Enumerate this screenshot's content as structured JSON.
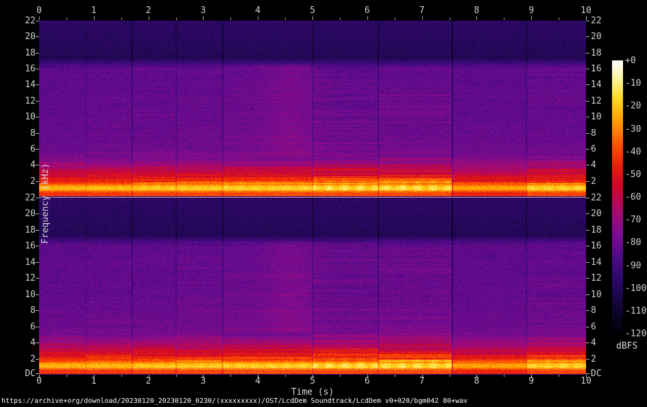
{
  "window": {
    "background": "#000000"
  },
  "footer": {
    "text": "https://archive+org/download/20230120_20230120_0230/(xxxxxxxxx)/OST/LcdDem Soundtrack/LcdDem v0+020/bgm042 80+wav"
  },
  "chart_data": {
    "type": "heatmap",
    "title": "",
    "description": "Stereo audio spectrogram (SoX style): two stacked channel panels, 0-10 s, DC-22 kHz, strong tonal energy below ~4.5 kHz, lowpass cutoff near 17 kHz, intensity scale 0 to -120 dBFS",
    "channels": 2,
    "x": {
      "label": "Time (s)",
      "min": 0,
      "max": 10,
      "major_ticks": [
        "0",
        "1",
        "2",
        "3",
        "4",
        "5",
        "6",
        "7",
        "8",
        "9",
        "10"
      ],
      "minor_step": 0.5
    },
    "y": {
      "label": "Frequency (kHz)",
      "min": 0,
      "max": 22,
      "tick_labels": [
        "22",
        "20",
        "18",
        "16",
        "14",
        "12",
        "10",
        "8",
        "6",
        "4",
        "2"
      ],
      "dc_label": "DC"
    },
    "colorbar": {
      "unit": "dBFS",
      "min": -120,
      "max": 0,
      "tick_labels": [
        "+0",
        "-10",
        "-20",
        "-30",
        "-40",
        "-50",
        "-60",
        "-70",
        "-80",
        "-90",
        "-100",
        "-110",
        "-120"
      ]
    },
    "palette_stops": [
      [
        0,
        255,
        255,
        255
      ],
      [
        -8,
        255,
        244,
        160
      ],
      [
        -16,
        255,
        220,
        40
      ],
      [
        -26,
        255,
        160,
        0
      ],
      [
        -36,
        255,
        90,
        0
      ],
      [
        -46,
        235,
        30,
        10
      ],
      [
        -56,
        205,
        5,
        45
      ],
      [
        -66,
        170,
        10,
        110
      ],
      [
        -76,
        125,
        12,
        145
      ],
      [
        -86,
        80,
        10,
        135
      ],
      [
        -96,
        45,
        8,
        105
      ],
      [
        -106,
        22,
        6,
        62
      ],
      [
        -114,
        8,
        3,
        28
      ],
      [
        -120,
        1,
        1,
        6
      ]
    ],
    "spectral_profile_khz_db": [
      [
        0.0,
        -36
      ],
      [
        0.08,
        -30
      ],
      [
        0.2,
        -40
      ],
      [
        0.45,
        -44
      ],
      [
        0.7,
        -36
      ],
      [
        0.85,
        -26
      ],
      [
        1.0,
        -22
      ],
      [
        1.3,
        -24
      ],
      [
        1.55,
        -34
      ],
      [
        1.85,
        -45
      ],
      [
        2.1,
        -50
      ],
      [
        2.6,
        -56
      ],
      [
        3.2,
        -62
      ],
      [
        4.0,
        -70
      ],
      [
        4.8,
        -77
      ],
      [
        6.0,
        -81
      ],
      [
        10,
        -83
      ],
      [
        16,
        -84
      ],
      [
        16.9,
        -94
      ],
      [
        17.3,
        -101
      ],
      [
        19,
        -99
      ],
      [
        22,
        -97
      ]
    ],
    "segments": [
      {
        "t0": 0,
        "t1": 0.85,
        "low_db": 0,
        "mid_db": 0,
        "striation": 0.7,
        "blob_db": 0
      },
      {
        "t0": 0.85,
        "t1": 1.7,
        "low_db": 1,
        "mid_db": 0.5,
        "striation": 0.85,
        "blob_db": 0
      },
      {
        "t0": 1.7,
        "t1": 2.5,
        "low_db": 2,
        "mid_db": 0.5,
        "striation": 0.9,
        "blob_db": 2
      },
      {
        "t0": 2.5,
        "t1": 3.35,
        "low_db": 2.5,
        "mid_db": 1,
        "striation": 0.95,
        "blob_db": 2
      },
      {
        "t0": 3.35,
        "t1": 5.0,
        "low_db": 3,
        "mid_db": 2,
        "striation": 1.0,
        "blob_db": 3
      },
      {
        "t0": 5.0,
        "t1": 6.2,
        "low_db": 3,
        "mid_db": 0.5,
        "striation": 1.55,
        "blob_db": 7
      },
      {
        "t0": 6.2,
        "t1": 7.55,
        "low_db": 3,
        "mid_db": 1.5,
        "striation": 1.6,
        "blob_db": 7
      },
      {
        "t0": 7.55,
        "t1": 8.9,
        "low_db": -2.5,
        "mid_db": 0,
        "striation": 0.7,
        "blob_db": 0
      },
      {
        "t0": 8.9,
        "t1": 10,
        "low_db": 2.5,
        "mid_db": 0.5,
        "striation": 1.2,
        "blob_db": 4
      }
    ],
    "boundaries_s": [
      [
        0.85,
        8
      ],
      [
        1.7,
        8
      ],
      [
        2.5,
        6
      ],
      [
        3.35,
        9
      ],
      [
        5.0,
        13
      ],
      [
        6.2,
        9
      ],
      [
        7.55,
        13
      ],
      [
        8.9,
        8
      ]
    ],
    "mid_column_boost": {
      "center_s": 4.6,
      "sigma_s": 0.35,
      "db": 4
    }
  }
}
